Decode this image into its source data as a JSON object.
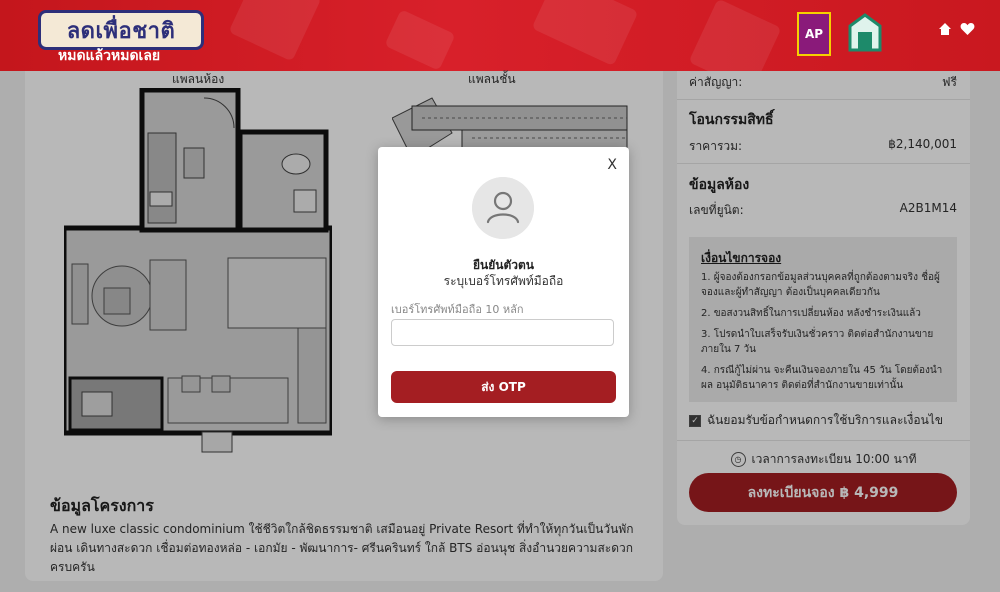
{
  "header": {
    "logo_text": "ลดเพื่อชาติ",
    "logo_sub": "หมดแล้วหมดเลย",
    "brand_ap_label": "AP",
    "home_icon": "home-icon",
    "heart_icon": "heart-icon"
  },
  "plans": {
    "room_label": "แพลนห้อง",
    "floor_label": "แพลนชั้น"
  },
  "project": {
    "title": "ข้อมูลโครงการ",
    "description": "A new luxe classic condominium ใช้ชีวิตใกล้ชิดธรรมชาติ เสมือนอยู่ Private Resort ที่ทำให้ทุกวันเป็นวันพักผ่อน เดินทางสะดวก เชื่อมต่อทองหล่อ - เอกมัย - พัฒนาการ- ศรีนครินทร์ ใกล้ BTS อ่อนนุช สิ่งอำนวยความสะดวกครบครัน"
  },
  "side": {
    "contract_label": "ค่าสัญญา:",
    "contract_value": "ฟรี",
    "transfer_title": "โอนกรรมสิทธิ์",
    "total_label": "ราคารวม:",
    "total_value": "฿2,140,001",
    "room_title": "ข้อมูลห้อง",
    "unit_label": "เลขที่ยูนิต:",
    "unit_value": "A2B1M14",
    "cond_title": "เงื่อนไขการจอง",
    "conditions": [
      "1. ผู้จองต้องกรอกข้อมูลส่วนบุคคลที่ถูกต้องตามจริง ชื่อผู้จองและผู้ทำสัญญา ต้องเป็นบุคคลเดียวกัน",
      "2. ขอสงวนสิทธิ์ในการเปลี่ยนห้อง หลังชำระเงินแล้ว",
      "3. โปรดนำใบเสร็จรับเงินชั่วคราว ติดต่อสำนักงานขาย ภายใน 7 วัน",
      "4. กรณีกู้ไม่ผ่าน จะคืนเงินจองภายใน 45 วัน โดยต้องนำผล อนุมัติธนาคาร ติดต่อที่สำนักงานขายเท่านั้น"
    ],
    "accept_label": "ฉันยอมรับข้อกำหนดการใช้บริการและเงื่อนไข",
    "timer_text": "เวลาการลงทะเบียน 10:00 นาที",
    "register_label": "ลงทะเบียนจอง ฿ 4,999"
  },
  "modal": {
    "close_label": "X",
    "title": "ยืนยันตัวตน",
    "subtitle": "ระบุเบอร์โทรศัพท์มือถือ",
    "field_label": "เบอร์โทรศัพท์มือถือ 10 หลัก",
    "phone_value": "",
    "send_label": "ส่ง OTP"
  },
  "colors": {
    "brand_red": "#c4161c",
    "button_red": "#a41e22"
  }
}
